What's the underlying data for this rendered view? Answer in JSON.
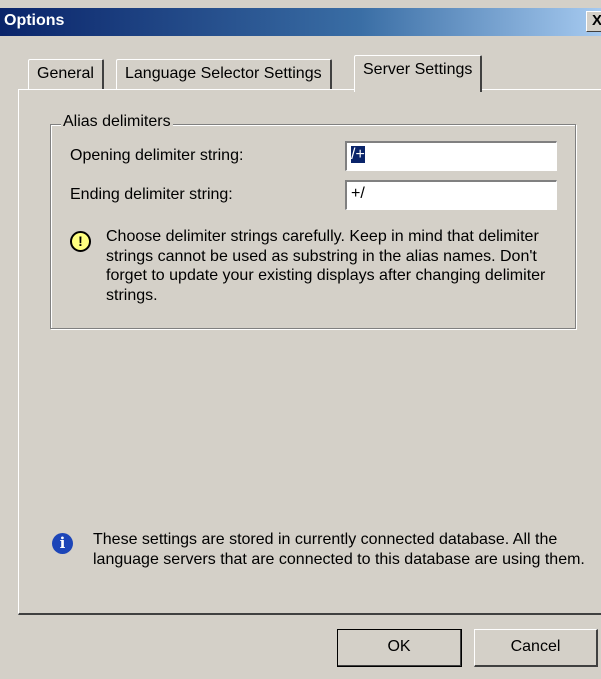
{
  "window": {
    "title": "Options",
    "close_label": "X"
  },
  "tabs": [
    {
      "label": "General",
      "active": false
    },
    {
      "label": "Language Selector Settings",
      "active": false
    },
    {
      "label": "Server Settings",
      "active": true
    }
  ],
  "alias_group": {
    "legend": "Alias delimiters",
    "opening_label": "Opening delimiter string:",
    "opening_value": "/+",
    "ending_label": "Ending delimiter string:",
    "ending_value": "+/",
    "warning_icon": "warning-icon",
    "warning_text": "Choose delimiter strings carefully. Keep in mind that delimiter strings cannot be used as substring in the alias names. Don't forget to update your existing displays after changing delimiter strings."
  },
  "info": {
    "icon": "info-icon",
    "text": "These settings are stored in currently connected database. All the language servers that are connected to this database are using them."
  },
  "buttons": {
    "ok": "OK",
    "cancel": "Cancel"
  }
}
